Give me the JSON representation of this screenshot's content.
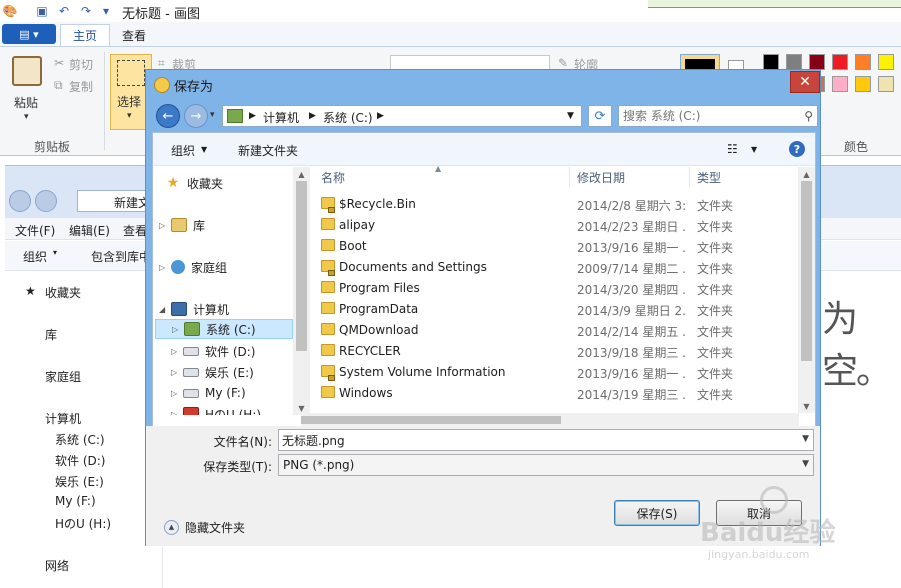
{
  "paint": {
    "title": "无标题 - 画图",
    "tabs": [
      "主页",
      "查看"
    ],
    "ribbon": {
      "paste": "粘贴",
      "cut": "剪切",
      "copy": "复制",
      "clipboard_group": "剪贴板",
      "select": "选择",
      "crop": "裁剪",
      "outline": "轮廓",
      "colors_group": "颜色"
    },
    "palette": [
      "#000000",
      "#7f7f7f",
      "#880015",
      "#ed1c24",
      "#ff7f27",
      "#fff200",
      "#ffffff",
      "#c3c3c3",
      "#b97a57",
      "#ffaec9",
      "#ffc90e",
      "#efe4b0"
    ]
  },
  "bg_explorer": {
    "address": "新建文",
    "menu": [
      "文件(F)",
      "编辑(E)",
      "查看"
    ],
    "toolbar": [
      "组织",
      "包含到库中"
    ],
    "sidebar": [
      "收藏夹",
      "库",
      "家庭组",
      "计算机",
      "系统 (C:)",
      "软件 (D:)",
      "娱乐 (E:)",
      "My (F:)",
      "HのU (H:)",
      "网络"
    ],
    "big_text": "为空。"
  },
  "dialog": {
    "title": "保存为",
    "close": "✕",
    "breadcrumb": [
      "计算机",
      "系统 (C:)"
    ],
    "search_placeholder": "搜索 系统 (C:)",
    "toolbar": {
      "organize": "组织",
      "new_folder": "新建文件夹"
    },
    "nav": {
      "favorites": "收藏夹",
      "libraries": "库",
      "homegroup": "家庭组",
      "computer": "计算机",
      "drive_c": "系统 (C:)",
      "drive_d": "软件 (D:)",
      "drive_e": "娱乐 (E:)",
      "drive_f": "My (F:)",
      "drive_h": "HのU (H:)"
    },
    "columns": {
      "name": "名称",
      "date": "修改日期",
      "type": "类型"
    },
    "files": [
      {
        "name": "$Recycle.Bin",
        "date": "2014/2/8 星期六 3:...",
        "type": "文件夹",
        "locked": true
      },
      {
        "name": "alipay",
        "date": "2014/2/23 星期日 ...",
        "type": "文件夹",
        "locked": false
      },
      {
        "name": "Boot",
        "date": "2013/9/16 星期一 ...",
        "type": "文件夹",
        "locked": false
      },
      {
        "name": "Documents and Settings",
        "date": "2009/7/14 星期二 ...",
        "type": "文件夹",
        "locked": true
      },
      {
        "name": "Program Files",
        "date": "2014/3/20 星期四 ...",
        "type": "文件夹",
        "locked": false
      },
      {
        "name": "ProgramData",
        "date": "2014/3/9 星期日 2...",
        "type": "文件夹",
        "locked": false
      },
      {
        "name": "QMDownload",
        "date": "2014/2/14 星期五 ...",
        "type": "文件夹",
        "locked": false
      },
      {
        "name": "RECYCLER",
        "date": "2013/9/18 星期三 ...",
        "type": "文件夹",
        "locked": false
      },
      {
        "name": "System Volume Information",
        "date": "2013/9/16 星期一 ...",
        "type": "文件夹",
        "locked": true
      },
      {
        "name": "Windows",
        "date": "2014/3/19 星期三 ...",
        "type": "文件夹",
        "locked": false
      }
    ],
    "filename_label": "文件名(N):",
    "filename_value": "无标题.png",
    "filetype_label": "保存类型(T):",
    "filetype_value": "PNG (*.png)",
    "hide_folders": "隐藏文件夹",
    "save": "保存(S)",
    "cancel": "取消"
  },
  "watermark": {
    "text": "Baidu经验",
    "url": "jingyan.baidu.com"
  }
}
